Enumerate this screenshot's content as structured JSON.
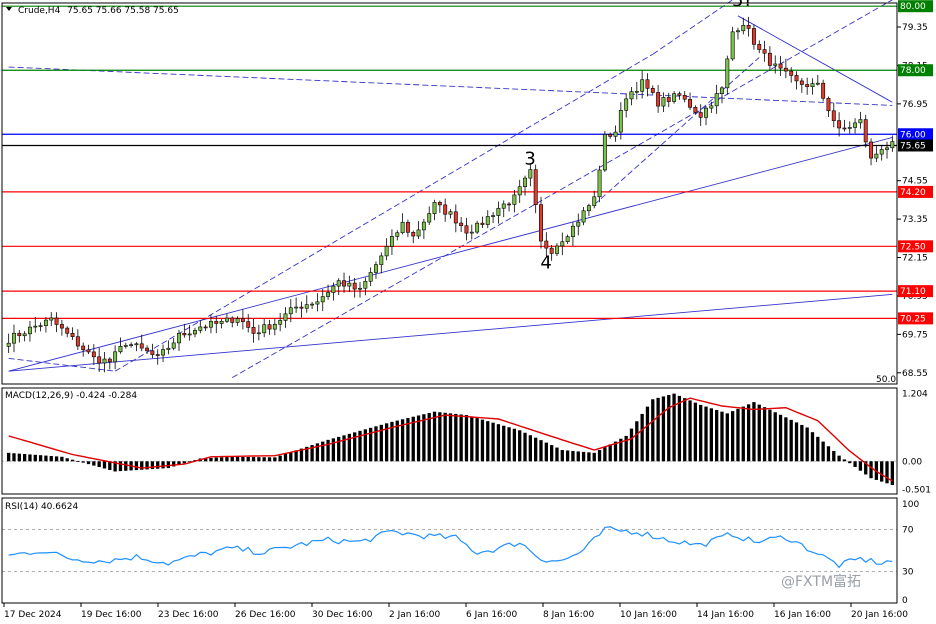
{
  "chart_data": {
    "type": "candlestick",
    "header": {
      "symbol_label": "Crude,H4",
      "ohlc": "75.65 75.66 75.58 75.65"
    },
    "price_axis": {
      "ticks": [
        "79.35",
        "78.15",
        "76.95",
        "74.55",
        "73.35",
        "72.15",
        "70.95",
        "69.75",
        "68.55"
      ],
      "tick_values": [
        79.35,
        78.15,
        76.95,
        74.55,
        73.35,
        72.15,
        70.95,
        69.75,
        68.55
      ],
      "range": [
        68.2,
        80.1
      ],
      "corner_label": "50.0"
    },
    "x_axis": {
      "labels": [
        "17 Dec 2024",
        "19 Dec 16:00",
        "23 Dec 16:00",
        "26 Dec 16:00",
        "30 Dec 16:00",
        "2 Jan 16:00",
        "6 Jan 16:00",
        "8 Jan 16:00",
        "10 Jan 16:00",
        "14 Jan 16:00",
        "16 Jan 16:00",
        "20 Jan 16:00"
      ]
    },
    "levels": [
      {
        "price": 80.0,
        "label": "80.00",
        "color": "#008000"
      },
      {
        "price": 78.0,
        "label": "78.00",
        "color": "#008000"
      },
      {
        "price": 76.0,
        "label": "76.00",
        "color": "#0000ff"
      },
      {
        "price": 75.65,
        "label": "75.65",
        "color": "#000000"
      },
      {
        "price": 74.2,
        "label": "74.20",
        "color": "#ff0000"
      },
      {
        "price": 72.5,
        "label": "72.50",
        "color": "#ff0000"
      },
      {
        "price": 71.1,
        "label": "71.10",
        "color": "#ff0000"
      },
      {
        "price": 70.25,
        "label": "70.25",
        "color": "#ff0000"
      }
    ],
    "wave_labels": [
      {
        "text": "3",
        "index": 98,
        "price": 75.05
      },
      {
        "text": "4",
        "index": 101,
        "price": 71.8
      },
      {
        "text": "5?",
        "index": 137,
        "price": 80.0
      }
    ],
    "macd": {
      "label": "MACD(12,26,9) -0.424 -0.284",
      "ticks": [
        "1.204",
        "0.00",
        "-0.501"
      ],
      "tick_values": [
        1.204,
        0,
        -0.501
      ],
      "range": [
        -0.58,
        1.3
      ],
      "histogram_keypoints": [
        [
          0,
          0.15
        ],
        [
          10,
          0.08
        ],
        [
          20,
          -0.18
        ],
        [
          30,
          -0.12
        ],
        [
          36,
          0.05
        ],
        [
          42,
          0.08
        ],
        [
          50,
          0.07
        ],
        [
          60,
          0.38
        ],
        [
          72,
          0.7
        ],
        [
          80,
          0.88
        ],
        [
          86,
          0.82
        ],
        [
          96,
          0.55
        ],
        [
          104,
          0.2
        ],
        [
          110,
          0.15
        ],
        [
          116,
          0.45
        ],
        [
          121,
          1.1
        ],
        [
          125,
          1.2
        ],
        [
          130,
          1.0
        ],
        [
          135,
          0.85
        ],
        [
          140,
          1.05
        ],
        [
          150,
          0.6
        ],
        [
          156,
          0.1
        ],
        [
          162,
          -0.3
        ],
        [
          166,
          -0.42
        ]
      ],
      "signal_keypoints": [
        [
          0,
          0.45
        ],
        [
          12,
          0.12
        ],
        [
          25,
          -0.12
        ],
        [
          33,
          -0.05
        ],
        [
          38,
          0.08
        ],
        [
          50,
          0.1
        ],
        [
          60,
          0.3
        ],
        [
          72,
          0.6
        ],
        [
          82,
          0.82
        ],
        [
          92,
          0.75
        ],
        [
          104,
          0.38
        ],
        [
          110,
          0.2
        ],
        [
          117,
          0.4
        ],
        [
          124,
          0.95
        ],
        [
          128,
          1.12
        ],
        [
          134,
          0.98
        ],
        [
          140,
          0.92
        ],
        [
          146,
          0.95
        ],
        [
          152,
          0.72
        ],
        [
          158,
          0.18
        ],
        [
          163,
          -0.18
        ],
        [
          166,
          -0.35
        ]
      ]
    },
    "rsi": {
      "label": "RSI(14) 40.6624",
      "ticks": [
        "100",
        "70",
        "30",
        "0"
      ],
      "tick_values": [
        100,
        70,
        30,
        0
      ],
      "levels": [
        70,
        30
      ],
      "range": [
        0,
        100
      ],
      "keypoints": [
        [
          0,
          45
        ],
        [
          6,
          50
        ],
        [
          12,
          42
        ],
        [
          18,
          40
        ],
        [
          24,
          44
        ],
        [
          30,
          38
        ],
        [
          36,
          46
        ],
        [
          42,
          52
        ],
        [
          48,
          48
        ],
        [
          54,
          55
        ],
        [
          60,
          60
        ],
        [
          66,
          58
        ],
        [
          72,
          68
        ],
        [
          78,
          64
        ],
        [
          84,
          62
        ],
        [
          88,
          48
        ],
        [
          92,
          52
        ],
        [
          96,
          58
        ],
        [
          100,
          42
        ],
        [
          104,
          40
        ],
        [
          108,
          50
        ],
        [
          112,
          70
        ],
        [
          118,
          68
        ],
        [
          124,
          60
        ],
        [
          130,
          55
        ],
        [
          136,
          66
        ],
        [
          140,
          58
        ],
        [
          146,
          63
        ],
        [
          152,
          47
        ],
        [
          156,
          36
        ],
        [
          160,
          42
        ],
        [
          164,
          38
        ],
        [
          166,
          40
        ]
      ]
    },
    "candles": {
      "count": 167,
      "close_keypoints": [
        [
          0,
          69.6
        ],
        [
          5,
          70.0
        ],
        [
          8,
          70.2
        ],
        [
          12,
          69.6
        ],
        [
          16,
          69.0
        ],
        [
          19,
          68.9
        ],
        [
          22,
          69.5
        ],
        [
          26,
          69.2
        ],
        [
          28,
          69.0
        ],
        [
          32,
          69.7
        ],
        [
          36,
          70.0
        ],
        [
          40,
          70.1
        ],
        [
          43,
          70.3
        ],
        [
          46,
          69.8
        ],
        [
          50,
          70.1
        ],
        [
          54,
          70.6
        ],
        [
          58,
          70.8
        ],
        [
          62,
          71.4
        ],
        [
          66,
          71.1
        ],
        [
          70,
          72.2
        ],
        [
          74,
          73.2
        ],
        [
          76,
          72.8
        ],
        [
          80,
          73.8
        ],
        [
          83,
          73.5
        ],
        [
          86,
          73.0
        ],
        [
          88,
          73.1
        ],
        [
          92,
          73.7
        ],
        [
          95,
          74.0
        ],
        [
          98,
          74.8
        ],
        [
          100,
          72.6
        ],
        [
          102,
          72.4
        ],
        [
          106,
          73.1
        ],
        [
          110,
          74.0
        ],
        [
          112,
          75.9
        ],
        [
          114,
          76.1
        ],
        [
          116,
          77.2
        ],
        [
          119,
          77.6
        ],
        [
          122,
          77.0
        ],
        [
          126,
          77.2
        ],
        [
          130,
          76.6
        ],
        [
          134,
          77.4
        ],
        [
          136,
          79.2
        ],
        [
          138,
          79.5
        ],
        [
          141,
          78.6
        ],
        [
          144,
          78.1
        ],
        [
          148,
          77.6
        ],
        [
          152,
          77.5
        ],
        [
          156,
          76.1
        ],
        [
          160,
          76.4
        ],
        [
          162,
          75.2
        ],
        [
          164,
          75.6
        ],
        [
          166,
          75.65
        ]
      ]
    },
    "watermark": "@FXTM富拓"
  }
}
